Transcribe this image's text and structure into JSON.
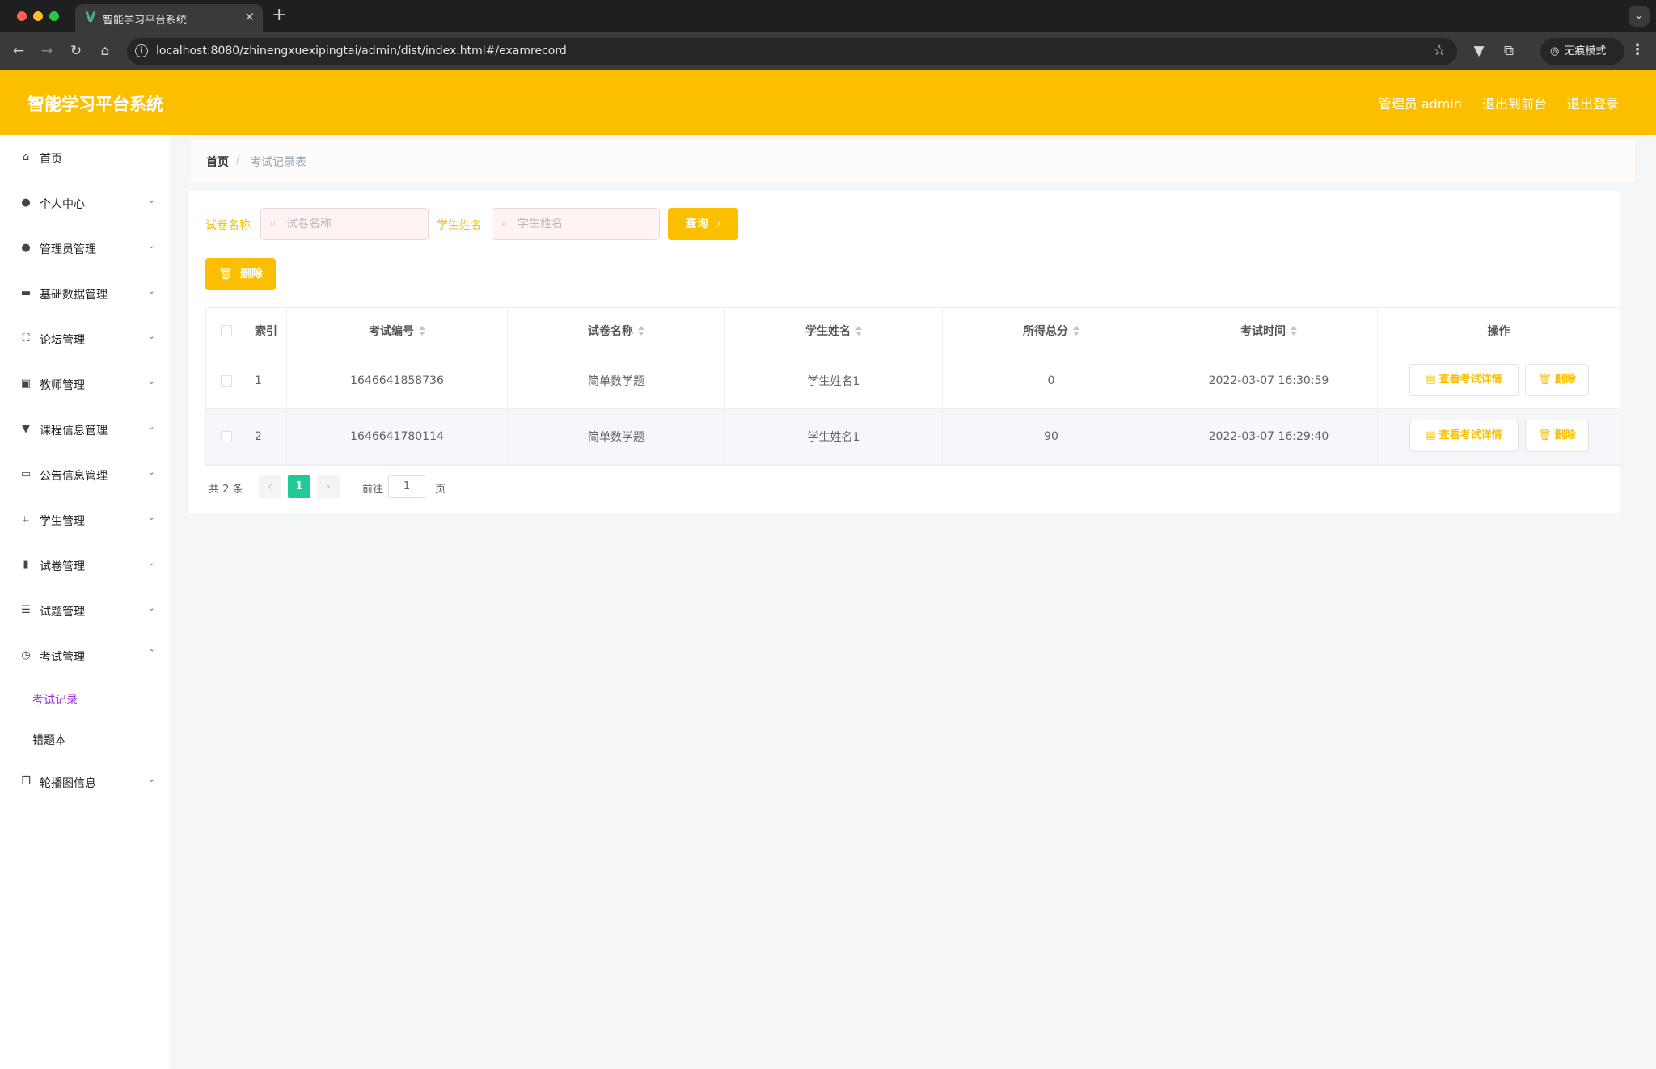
{
  "browser": {
    "tab_title": "智能学习平台系统",
    "url": "localhost:8080/zhinengxuexipingtai/admin/dist/index.html#/examrecord",
    "incognito_label": "无痕模式"
  },
  "header": {
    "title": "智能学习平台系统",
    "user": "管理员 admin",
    "to_front": "退出到前台",
    "logout": "退出登录",
    "color": "#fbbf00"
  },
  "sidebar": {
    "items": [
      {
        "label": "首页",
        "icon": "home-icon"
      },
      {
        "label": "个人中心",
        "icon": "user-icon"
      },
      {
        "label": "管理员管理",
        "icon": "bulb-icon"
      },
      {
        "label": "基础数据管理",
        "icon": "ticket-icon"
      },
      {
        "label": "论坛管理",
        "icon": "fullscreen-icon"
      },
      {
        "label": "教师管理",
        "icon": "clipboard-icon"
      },
      {
        "label": "课程信息管理",
        "icon": "board-icon"
      },
      {
        "label": "公告信息管理",
        "icon": "postcard-icon"
      },
      {
        "label": "学生管理",
        "icon": "crop-icon"
      },
      {
        "label": "试卷管理",
        "icon": "bar-chart-icon"
      },
      {
        "label": "试题管理",
        "icon": "list-icon"
      },
      {
        "label": "考试管理",
        "icon": "compass-icon"
      },
      {
        "label": "轮播图信息",
        "icon": "copy-icon"
      }
    ],
    "sub_items": [
      {
        "label": "考试记录",
        "active": true
      },
      {
        "label": "错题本",
        "active": false
      }
    ],
    "active_color": "#9b30d9"
  },
  "breadcrumb": {
    "home": "首页",
    "separator": "/",
    "current": "考试记录表"
  },
  "filters": {
    "paper_label": "试卷名称",
    "paper_placeholder": "试卷名称",
    "student_label": "学生姓名",
    "student_placeholder": "学生姓名",
    "query_button": "查询",
    "delete_button": "删除"
  },
  "table": {
    "columns": [
      "索引",
      "考试编号",
      "试卷名称",
      "学生姓名",
      "所得总分",
      "考试时间",
      "操作"
    ],
    "rows": [
      {
        "index": "1",
        "exam_no": "1646641858736",
        "paper": "简单数学题",
        "student": "学生姓名1",
        "score": "0",
        "time": "2022-03-07 16:30:59"
      },
      {
        "index": "2",
        "exam_no": "1646641780114",
        "paper": "简单数学题",
        "student": "学生姓名1",
        "score": "90",
        "time": "2022-03-07 16:29:40"
      }
    ],
    "detail_button": "查看考试详情",
    "delete_button": "删除"
  },
  "pagination": {
    "total_text": "共 2 条",
    "current_page": "1",
    "goto_label": "前往",
    "goto_value": "1",
    "page_suffix": "页"
  }
}
